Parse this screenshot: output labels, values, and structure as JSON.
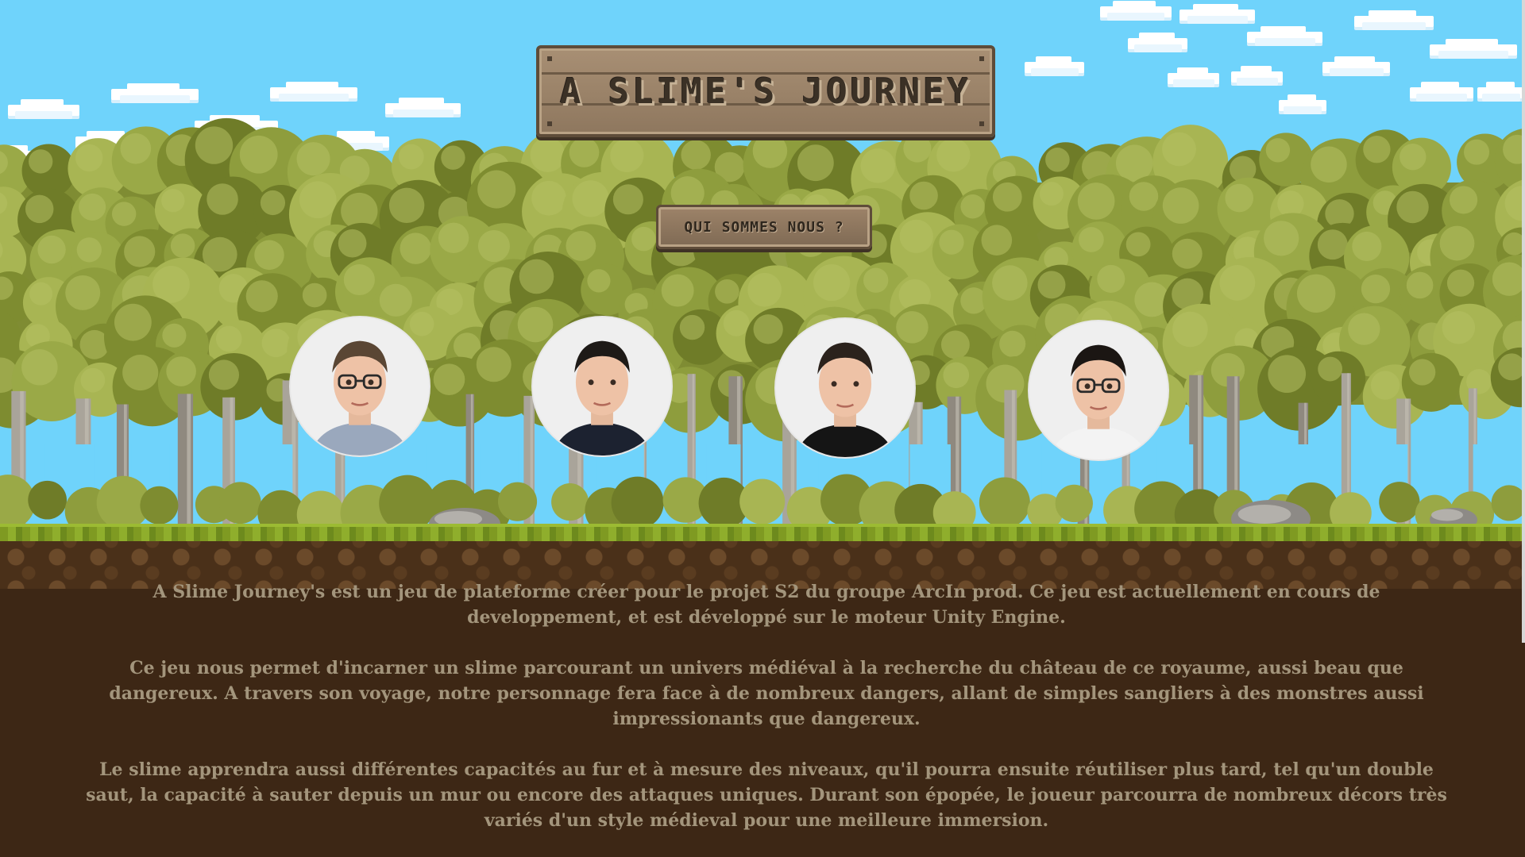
{
  "header": {
    "title": "A SLIME'S JOURNEY",
    "about_button_label": "QUI SOMMES NOUS ?"
  },
  "team": [
    {
      "avatar": "member-1",
      "shirt_color": "#9aa8bd",
      "glasses": true,
      "hair_color": "#5a4634"
    },
    {
      "avatar": "member-2",
      "shirt_color": "#1c2230",
      "glasses": false,
      "hair_color": "#1e1a17"
    },
    {
      "avatar": "member-3",
      "shirt_color": "#151515",
      "glasses": false,
      "hair_color": "#2b221c"
    },
    {
      "avatar": "member-4",
      "shirt_color": "#f3f3f3",
      "glasses": true,
      "hair_color": "#1b1613"
    }
  ],
  "description": {
    "paragraphs": [
      "A Slime Journey's est un jeu de plateforme créer pour le projet S2 du groupe ArcIn prod. Ce jeu est actuellement en cours de developpement, et est développé sur le moteur Unity Engine.",
      "Ce jeu nous permet d'incarner un slime parcourant un univers médiéval à la recherche du château de ce royaume, aussi beau que dangereux. A travers son voyage, notre personnage fera face à de nombreux dangers, allant de simples sangliers à des monstres aussi impressionants que dangereux.",
      "Le slime apprendra aussi différentes capacités au fur et à mesure des niveaux, qu'il pourra ensuite réutiliser plus tard, tel qu'un double saut, la capacité à sauter depuis un mur ou encore des attaques uniques. Durant son épopée, le joueur parcourra de nombreux décors très variés d'un style médieval pour une meilleure immersion."
    ]
  },
  "colors": {
    "sky": "#6fd3fb",
    "foliage": "#8a9a3a",
    "trunk": "#a9a49a",
    "ground": "#3d2715",
    "text": "#a3957c",
    "sign": "#9c8367"
  },
  "icons": [
    "cloud",
    "tree",
    "rock"
  ]
}
